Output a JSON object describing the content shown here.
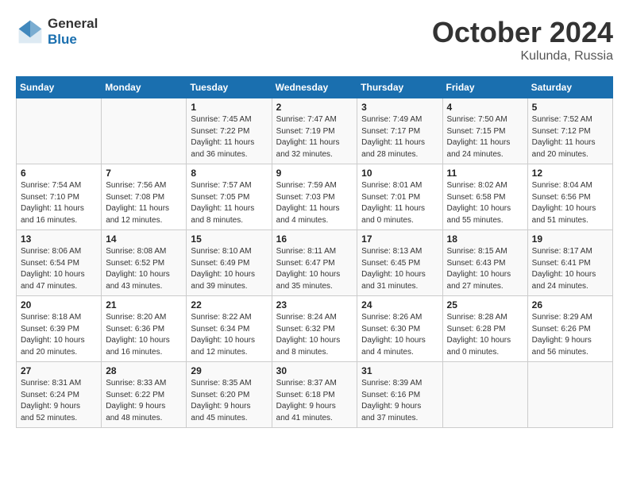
{
  "header": {
    "logo_general": "General",
    "logo_blue": "Blue",
    "month": "October 2024",
    "location": "Kulunda, Russia"
  },
  "days_of_week": [
    "Sunday",
    "Monday",
    "Tuesday",
    "Wednesday",
    "Thursday",
    "Friday",
    "Saturday"
  ],
  "weeks": [
    [
      {
        "day": "",
        "info": ""
      },
      {
        "day": "",
        "info": ""
      },
      {
        "day": "1",
        "info": "Sunrise: 7:45 AM\nSunset: 7:22 PM\nDaylight: 11 hours\nand 36 minutes."
      },
      {
        "day": "2",
        "info": "Sunrise: 7:47 AM\nSunset: 7:19 PM\nDaylight: 11 hours\nand 32 minutes."
      },
      {
        "day": "3",
        "info": "Sunrise: 7:49 AM\nSunset: 7:17 PM\nDaylight: 11 hours\nand 28 minutes."
      },
      {
        "day": "4",
        "info": "Sunrise: 7:50 AM\nSunset: 7:15 PM\nDaylight: 11 hours\nand 24 minutes."
      },
      {
        "day": "5",
        "info": "Sunrise: 7:52 AM\nSunset: 7:12 PM\nDaylight: 11 hours\nand 20 minutes."
      }
    ],
    [
      {
        "day": "6",
        "info": "Sunrise: 7:54 AM\nSunset: 7:10 PM\nDaylight: 11 hours\nand 16 minutes."
      },
      {
        "day": "7",
        "info": "Sunrise: 7:56 AM\nSunset: 7:08 PM\nDaylight: 11 hours\nand 12 minutes."
      },
      {
        "day": "8",
        "info": "Sunrise: 7:57 AM\nSunset: 7:05 PM\nDaylight: 11 hours\nand 8 minutes."
      },
      {
        "day": "9",
        "info": "Sunrise: 7:59 AM\nSunset: 7:03 PM\nDaylight: 11 hours\nand 4 minutes."
      },
      {
        "day": "10",
        "info": "Sunrise: 8:01 AM\nSunset: 7:01 PM\nDaylight: 11 hours\nand 0 minutes."
      },
      {
        "day": "11",
        "info": "Sunrise: 8:02 AM\nSunset: 6:58 PM\nDaylight: 10 hours\nand 55 minutes."
      },
      {
        "day": "12",
        "info": "Sunrise: 8:04 AM\nSunset: 6:56 PM\nDaylight: 10 hours\nand 51 minutes."
      }
    ],
    [
      {
        "day": "13",
        "info": "Sunrise: 8:06 AM\nSunset: 6:54 PM\nDaylight: 10 hours\nand 47 minutes."
      },
      {
        "day": "14",
        "info": "Sunrise: 8:08 AM\nSunset: 6:52 PM\nDaylight: 10 hours\nand 43 minutes."
      },
      {
        "day": "15",
        "info": "Sunrise: 8:10 AM\nSunset: 6:49 PM\nDaylight: 10 hours\nand 39 minutes."
      },
      {
        "day": "16",
        "info": "Sunrise: 8:11 AM\nSunset: 6:47 PM\nDaylight: 10 hours\nand 35 minutes."
      },
      {
        "day": "17",
        "info": "Sunrise: 8:13 AM\nSunset: 6:45 PM\nDaylight: 10 hours\nand 31 minutes."
      },
      {
        "day": "18",
        "info": "Sunrise: 8:15 AM\nSunset: 6:43 PM\nDaylight: 10 hours\nand 27 minutes."
      },
      {
        "day": "19",
        "info": "Sunrise: 8:17 AM\nSunset: 6:41 PM\nDaylight: 10 hours\nand 24 minutes."
      }
    ],
    [
      {
        "day": "20",
        "info": "Sunrise: 8:18 AM\nSunset: 6:39 PM\nDaylight: 10 hours\nand 20 minutes."
      },
      {
        "day": "21",
        "info": "Sunrise: 8:20 AM\nSunset: 6:36 PM\nDaylight: 10 hours\nand 16 minutes."
      },
      {
        "day": "22",
        "info": "Sunrise: 8:22 AM\nSunset: 6:34 PM\nDaylight: 10 hours\nand 12 minutes."
      },
      {
        "day": "23",
        "info": "Sunrise: 8:24 AM\nSunset: 6:32 PM\nDaylight: 10 hours\nand 8 minutes."
      },
      {
        "day": "24",
        "info": "Sunrise: 8:26 AM\nSunset: 6:30 PM\nDaylight: 10 hours\nand 4 minutes."
      },
      {
        "day": "25",
        "info": "Sunrise: 8:28 AM\nSunset: 6:28 PM\nDaylight: 10 hours\nand 0 minutes."
      },
      {
        "day": "26",
        "info": "Sunrise: 8:29 AM\nSunset: 6:26 PM\nDaylight: 9 hours\nand 56 minutes."
      }
    ],
    [
      {
        "day": "27",
        "info": "Sunrise: 8:31 AM\nSunset: 6:24 PM\nDaylight: 9 hours\nand 52 minutes."
      },
      {
        "day": "28",
        "info": "Sunrise: 8:33 AM\nSunset: 6:22 PM\nDaylight: 9 hours\nand 48 minutes."
      },
      {
        "day": "29",
        "info": "Sunrise: 8:35 AM\nSunset: 6:20 PM\nDaylight: 9 hours\nand 45 minutes."
      },
      {
        "day": "30",
        "info": "Sunrise: 8:37 AM\nSunset: 6:18 PM\nDaylight: 9 hours\nand 41 minutes."
      },
      {
        "day": "31",
        "info": "Sunrise: 8:39 AM\nSunset: 6:16 PM\nDaylight: 9 hours\nand 37 minutes."
      },
      {
        "day": "",
        "info": ""
      },
      {
        "day": "",
        "info": ""
      }
    ]
  ]
}
